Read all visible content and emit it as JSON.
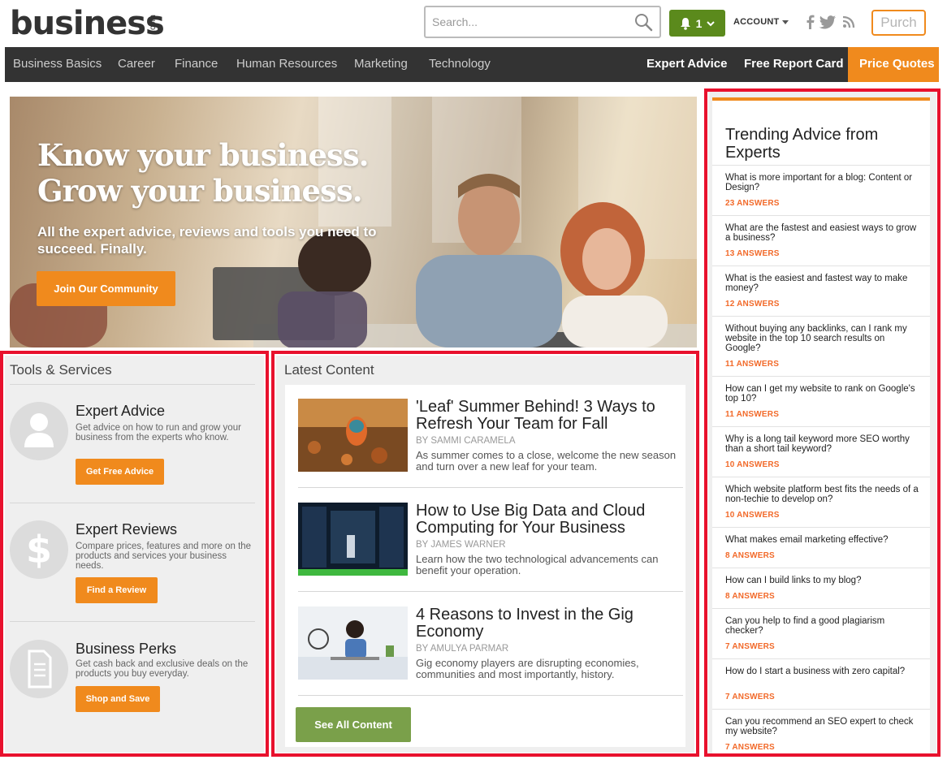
{
  "header": {
    "logo": "business",
    "logo_suffix": ".com",
    "search_placeholder": "Search...",
    "notification_count": "1",
    "account_label": "ACCOUNT",
    "purchase_label": "Purch"
  },
  "nav": {
    "items": [
      "Business Basics",
      "Career",
      "Finance",
      "Human Resources",
      "Marketing",
      "Technology"
    ],
    "right_items": [
      "Expert Advice",
      "Free Report Card"
    ],
    "price_quotes": "Price Quotes"
  },
  "hero": {
    "title_line1": "Know your business.",
    "title_line2": "Grow your business.",
    "subtitle": "All the expert advice, reviews and tools you need to succeed. Finally.",
    "cta": "Join Our Community"
  },
  "tools": {
    "title": "Tools & Services",
    "items": [
      {
        "heading": "Expert Advice",
        "desc": "Get advice on how to run and grow your business from the experts who know.",
        "button": "Get Free Advice",
        "icon": "person-icon"
      },
      {
        "heading": "Expert Reviews",
        "desc": "Compare prices, features and more on the products and services your business needs.",
        "button": "Find a Review",
        "icon": "dollar-icon"
      },
      {
        "heading": "Business Perks",
        "desc": "Get cash back and exclusive deals on the products you buy everyday.",
        "button": "Shop and Save",
        "icon": "document-icon"
      }
    ]
  },
  "latest": {
    "title": "Latest Content",
    "articles": [
      {
        "title": "'Leaf' Summer Behind! 3 Ways to Refresh Your Team for Fall",
        "by": "BY SAMMI CARAMELA",
        "desc": "As summer comes to a close, welcome the new season and turn over a new leaf for your team."
      },
      {
        "title": "How to Use Big Data and Cloud Computing for Your Business",
        "by": "BY JAMES WARNER",
        "desc": "Learn how the two technological advancements can benefit your operation."
      },
      {
        "title": "4 Reasons to Invest in the Gig Economy",
        "by": "BY AMULYA PARMAR",
        "desc": "Gig economy players are disrupting economies, communities and most importantly, history."
      }
    ],
    "see_all": "See All Content"
  },
  "trending": {
    "title": "Trending Advice from Experts",
    "questions": [
      {
        "q": "What is more important for a blog: Content or Design?",
        "a": "23 ANSWERS"
      },
      {
        "q": "What are the fastest and easiest ways to grow a business?",
        "a": "13 ANSWERS"
      },
      {
        "q": "What is the easiest and fastest way to make money?",
        "a": "12 ANSWERS"
      },
      {
        "q": "Without buying any backlinks, can I rank my website in the top 10 search results on Google?",
        "a": "11 ANSWERS"
      },
      {
        "q": "How can I get my website to rank on Google's top 10?",
        "a": "11 ANSWERS"
      },
      {
        "q": "Why is a long tail keyword more SEO worthy than a short tail keyword?",
        "a": "10 ANSWERS"
      },
      {
        "q": "Which website platform best fits the needs of a non-techie to develop on?",
        "a": "10 ANSWERS"
      },
      {
        "q": "What makes email marketing effective?",
        "a": "8 ANSWERS"
      },
      {
        "q": "How can I build links to my blog?",
        "a": "8 ANSWERS"
      },
      {
        "q": "Can you help to find a good plagiarism checker?",
        "a": "7 ANSWERS"
      },
      {
        "q": "How do I start a business with zero capital?",
        "a": "7 ANSWERS"
      },
      {
        "q": "Can you recommend an SEO expert to check my website?",
        "a": "7 ANSWERS"
      }
    ]
  },
  "colors": {
    "accent_orange": "#f08a1d",
    "nav_bg": "#333333",
    "notif_green": "#5b8a1c",
    "see_all_green": "#7aa04a",
    "highlight_red": "#e8112d"
  }
}
